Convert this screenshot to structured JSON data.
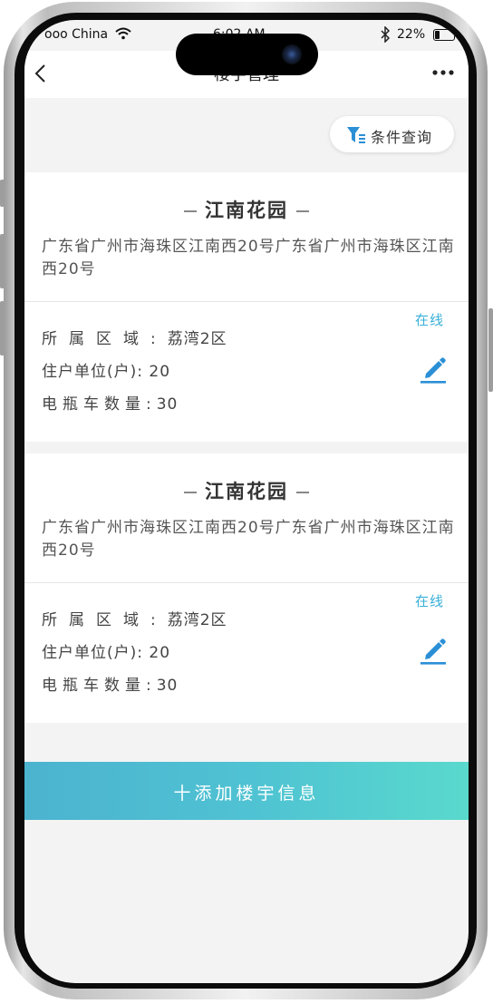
{
  "status_bar": {
    "carrier": "ooo China",
    "time": "6:02 AM",
    "battery": "22%"
  },
  "nav": {
    "title": "楼宇管理"
  },
  "filter": {
    "label": "条件查询"
  },
  "buildings": [
    {
      "name": "江南花园",
      "address": "广东省广州市海珠区江南西20号广东省广州市海珠区江南西20号",
      "status": "在线",
      "area_label": "所属区域:",
      "area_value": "荔湾2区",
      "units_label": "住户单位(户):",
      "units_value": "20",
      "ev_label": "电瓶车数量:",
      "ev_value": "30"
    },
    {
      "name": "江南花园",
      "address": "广东省广州市海珠区江南西20号广东省广州市海珠区江南西20号",
      "status": "在线",
      "area_label": "所属区域:",
      "area_value": "荔湾2区",
      "units_label": "住户单位(户):",
      "units_value": "20",
      "ev_label": "电瓶车数量:",
      "ev_value": "30"
    }
  ],
  "add_button": {
    "label": "十添加楼宇信息"
  },
  "colors": {
    "accent": "#3ab0d8",
    "status_online": "#3ab0d8",
    "button_gradient_start": "#4cb3cf",
    "button_gradient_end": "#59d9cd",
    "page_background": "#f3f3f3"
  },
  "icons": [
    "back-icon",
    "more-icon",
    "filter-icon",
    "edit-icon",
    "wifi-icon",
    "bluetooth-icon",
    "battery-icon"
  ]
}
